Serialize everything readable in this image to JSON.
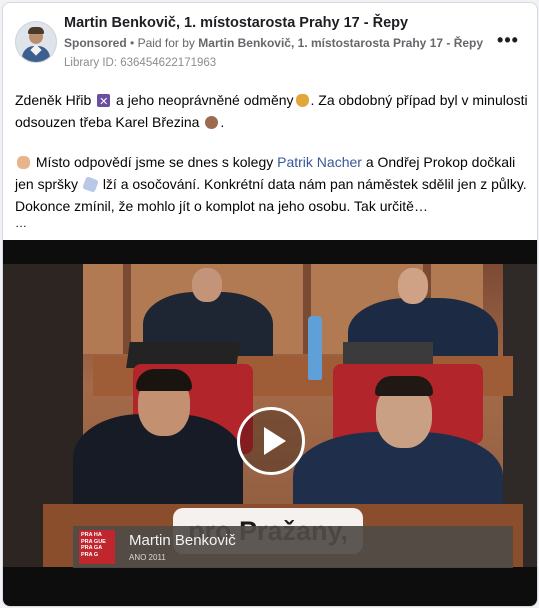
{
  "post": {
    "page_name": "Martin Benkovič, 1. místostarosta Prahy 17 - Řepy",
    "sponsored_label": "Sponsored",
    "paid_for_prefix": "Paid for by",
    "paid_for_name": "Martin Benkovič, 1. místostarosta Prahy 17 - Řepy",
    "library_id": "Library ID: 636454622171963",
    "more_options": "•••",
    "paragraph1": {
      "part1": "Zdeněk Hřib",
      "part2": "a jeho neoprávněné odměny",
      "part3": ". Za obdobný případ byl v minulosti odsouzen třeba Karel Březina",
      "part4": "."
    },
    "paragraph2": {
      "part1": "Místo odpovědí jsme se dnes s kolegy",
      "link": "Patrik Nacher",
      "part2": "a Ondřej Prokop dočkali jen spršky",
      "part3": "lží a osočování. Konkrétní data nám pan náměstek sdělil jen z půlky. Dokonce zmínil, že mohlo jít o komplot na jeho osobu. Tak určitě…"
    },
    "ellipsis": "…",
    "emojis": [
      "x-flag-icon",
      "money-bag-icon",
      "bear-icon",
      "pointing-hand-icon",
      "sparkles-icon"
    ]
  },
  "video": {
    "subtitle": "pro Pražany,",
    "speaker_name": "Martin Benkovič",
    "speaker_party": "ANO 2011",
    "logo_text": "PRA HA PRA GUE PRA GA PRA G",
    "play_label": "play-icon"
  }
}
